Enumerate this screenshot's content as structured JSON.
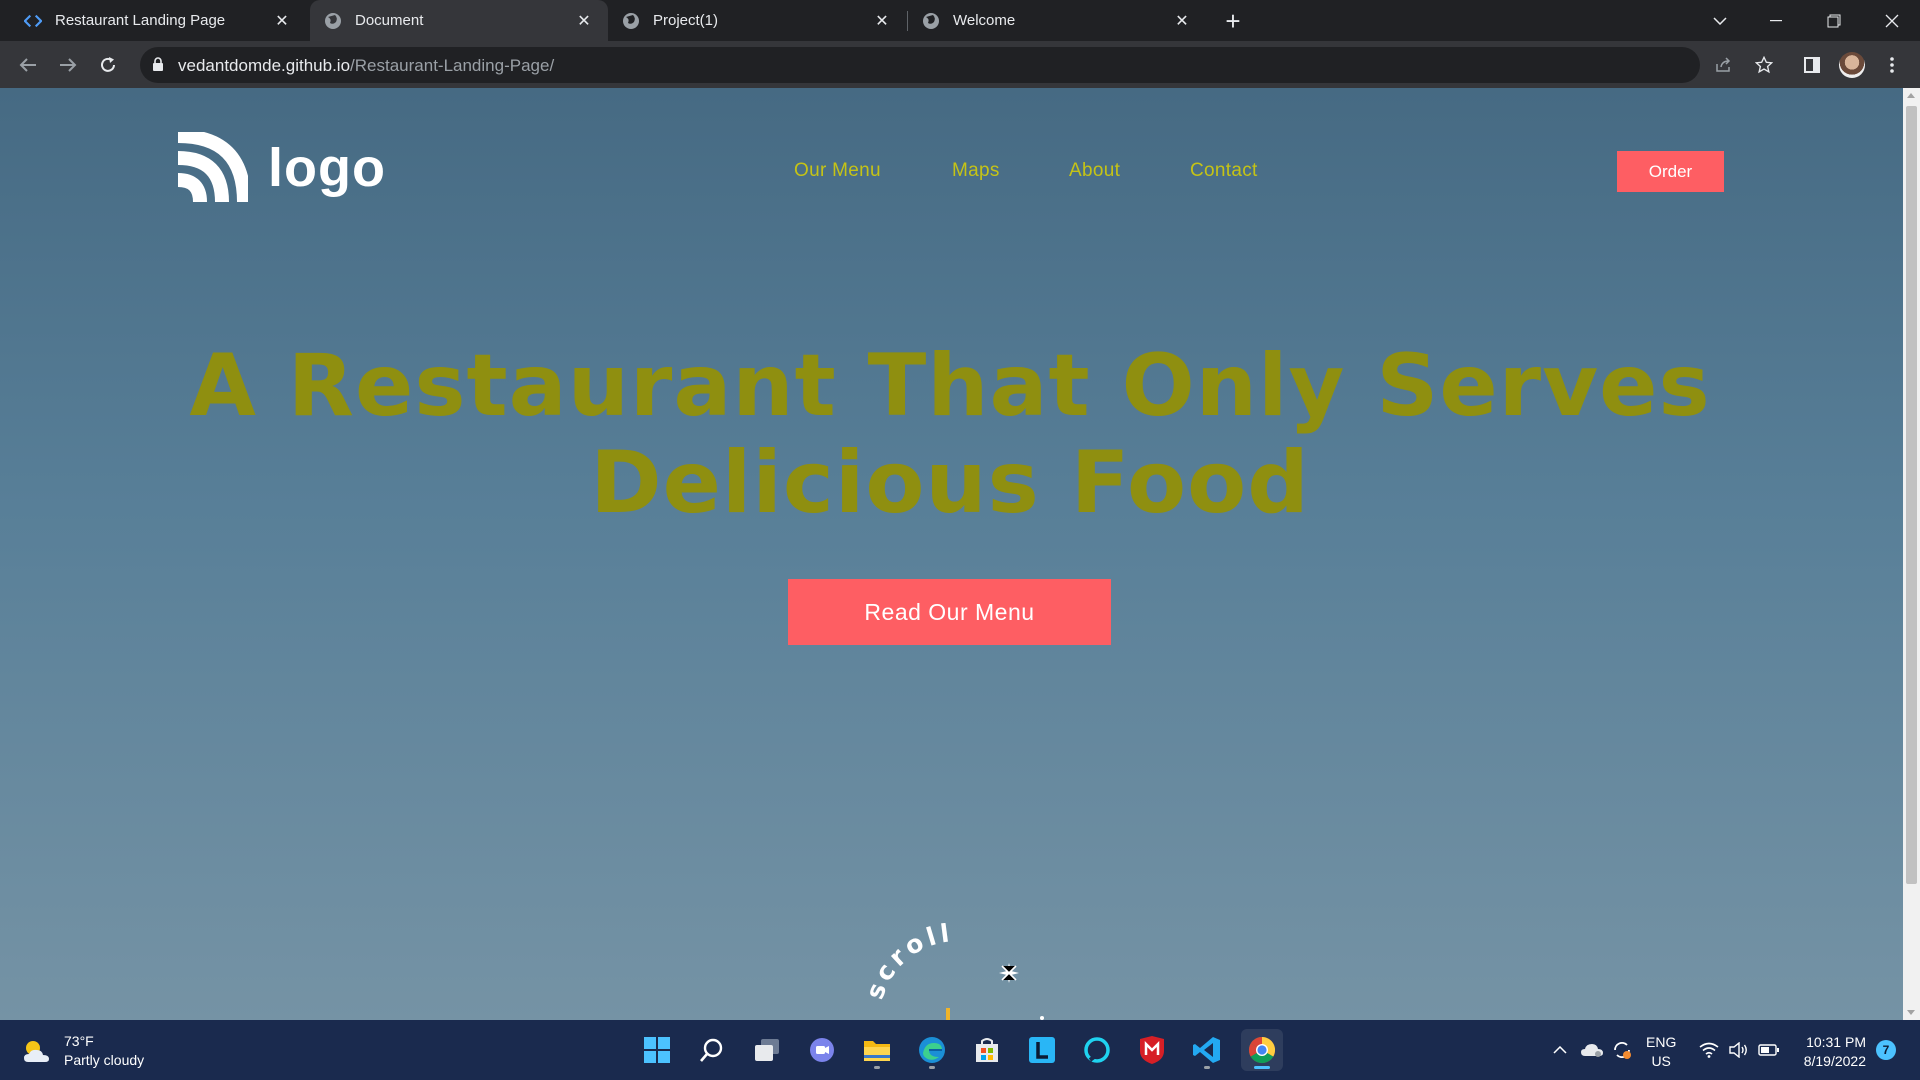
{
  "browser": {
    "tabs": [
      {
        "title": "Restaurant Landing Page",
        "icon": "code-brackets-icon",
        "active": false
      },
      {
        "title": "Document",
        "icon": "globe-icon",
        "active": true
      },
      {
        "title": "Project(1)",
        "icon": "globe-icon",
        "active": false
      },
      {
        "title": "Welcome",
        "icon": "globe-icon",
        "active": false
      }
    ],
    "url_domain": "vedantdomde.github.io",
    "url_path": "/Restaurant-Landing-Page/"
  },
  "page": {
    "logo_text": "logo",
    "nav": [
      "Our Menu",
      "Maps",
      "About",
      "Contact"
    ],
    "order_label": "Order",
    "hero_title": "A Restaurant That Only Serves Delicious Food",
    "menu_button_label": "Read Our Menu",
    "scroll_label": "scroll",
    "colors": {
      "nav_text": "#c5c316",
      "hero_text": "#8f8f10",
      "accent": "#fe5e63",
      "background_top": "#466a83",
      "background_bottom": "#7593a5"
    }
  },
  "taskbar": {
    "weather_temp": "73°F",
    "weather_desc": "Partly cloudy",
    "apps": [
      "start-icon",
      "search-icon",
      "task-view-icon",
      "teams-chat-icon",
      "file-explorer-icon",
      "edge-icon",
      "store-icon",
      "l-app-icon",
      "alexa-icon",
      "mcafee-icon",
      "vscode-icon",
      "chrome-icon"
    ],
    "lang_top": "ENG",
    "lang_bottom": "US",
    "time": "10:31 PM",
    "date": "8/19/2022",
    "notification_count": "7"
  }
}
